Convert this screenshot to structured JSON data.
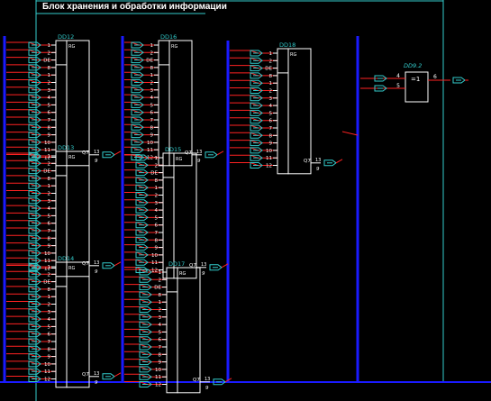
{
  "title": "Блок хранения и обработки информации",
  "colors": {
    "background": "#000000",
    "frame": "#33cccc",
    "bus": "#1a1aff",
    "wire": "#ff2222",
    "chip": "#ffffff",
    "chip_label": "#33cccc",
    "pin": "#ffffff",
    "connector": "#33cccc"
  },
  "chips": [
    {
      "ref": "DD12",
      "func": "RG",
      "inputs": [
        "1",
        "2",
        "DE",
        "8",
        "1",
        "2",
        "3",
        "4",
        "5",
        "6",
        "7",
        "8",
        "9",
        "10",
        "11",
        "12"
      ],
      "output_pin": "Q7",
      "output_num": "13",
      "output_sub": "9"
    },
    {
      "ref": "DD13",
      "func": "RG",
      "inputs": [
        "1",
        "2",
        "DE",
        "8",
        "1",
        "2",
        "3",
        "4",
        "5",
        "6",
        "7",
        "8",
        "9",
        "10",
        "11",
        "12"
      ],
      "output_pin": "Q7",
      "output_num": "13",
      "output_sub": "9"
    },
    {
      "ref": "DD14",
      "func": "RG",
      "inputs": [
        "1",
        "2",
        "DE",
        "8",
        "1",
        "2",
        "3",
        "4",
        "5",
        "6",
        "7",
        "8",
        "9",
        "10",
        "11",
        "12"
      ],
      "output_pin": "Q7",
      "output_num": "13",
      "output_sub": "9"
    },
    {
      "ref": "DD16",
      "func": "RG",
      "inputs": [
        "1",
        "2",
        "DE",
        "8",
        "1",
        "2",
        "3",
        "4",
        "5",
        "6",
        "7",
        "8",
        "9",
        "10",
        "11",
        "12"
      ],
      "output_pin": "Q7",
      "output_num": "13",
      "output_sub": "9"
    },
    {
      "ref": "DD15",
      "func": "RG",
      "inputs": [
        "1",
        "2",
        "DE",
        "8",
        "1",
        "2",
        "3",
        "4",
        "5",
        "6",
        "7",
        "8",
        "9",
        "10",
        "11",
        "12"
      ],
      "output_pin": "Q7",
      "output_num": "13",
      "output_sub": "9"
    },
    {
      "ref": "DD17",
      "func": "RG",
      "inputs": [
        "1",
        "2",
        "DE",
        "8",
        "1",
        "2",
        "3",
        "4",
        "5",
        "6",
        "7",
        "8",
        "9",
        "10",
        "11",
        "12"
      ],
      "output_pin": "Q7",
      "output_num": "13",
      "output_sub": "9"
    },
    {
      "ref": "DD18",
      "func": "RG",
      "inputs": [
        "1",
        "2",
        "DE",
        "8",
        "1",
        "2",
        "3",
        "4",
        "5",
        "6",
        "7",
        "8",
        "9",
        "10",
        "11",
        "12"
      ],
      "output_pin": "Q7",
      "output_num": "13",
      "output_sub": "9"
    }
  ],
  "gate": {
    "ref": "DD9.2",
    "func": "=1",
    "inputs": [
      "4",
      "5"
    ],
    "output": "6"
  }
}
